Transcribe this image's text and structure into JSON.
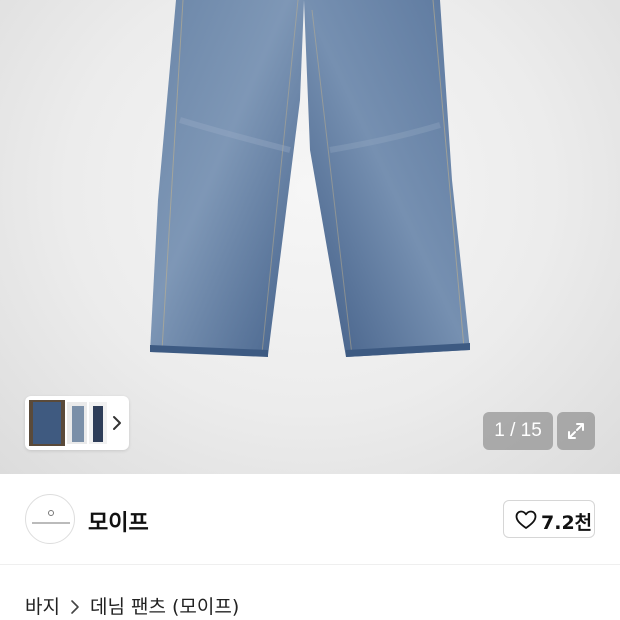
{
  "gallery": {
    "current_index": "1",
    "total": "15",
    "counter_text": "1 / 15",
    "image_subject": "wide-leg denim jeans (washed blue)",
    "thumbnail_count_visible": 3
  },
  "icons": {
    "thumbnail_next": "chevron-right-icon",
    "expand": "expand-arrows-icon",
    "like": "heart-outline-icon",
    "breadcrumb_separator": "chevron-right-icon"
  },
  "brand": {
    "name": "모이프",
    "like_count": "7.2천"
  },
  "breadcrumb": {
    "category": "바지",
    "product": "데님 팬츠 (모이프)"
  },
  "colors": {
    "background": "#ffffff",
    "denim": "#4f6d94",
    "text": "#111111",
    "overlay": "#808080"
  }
}
